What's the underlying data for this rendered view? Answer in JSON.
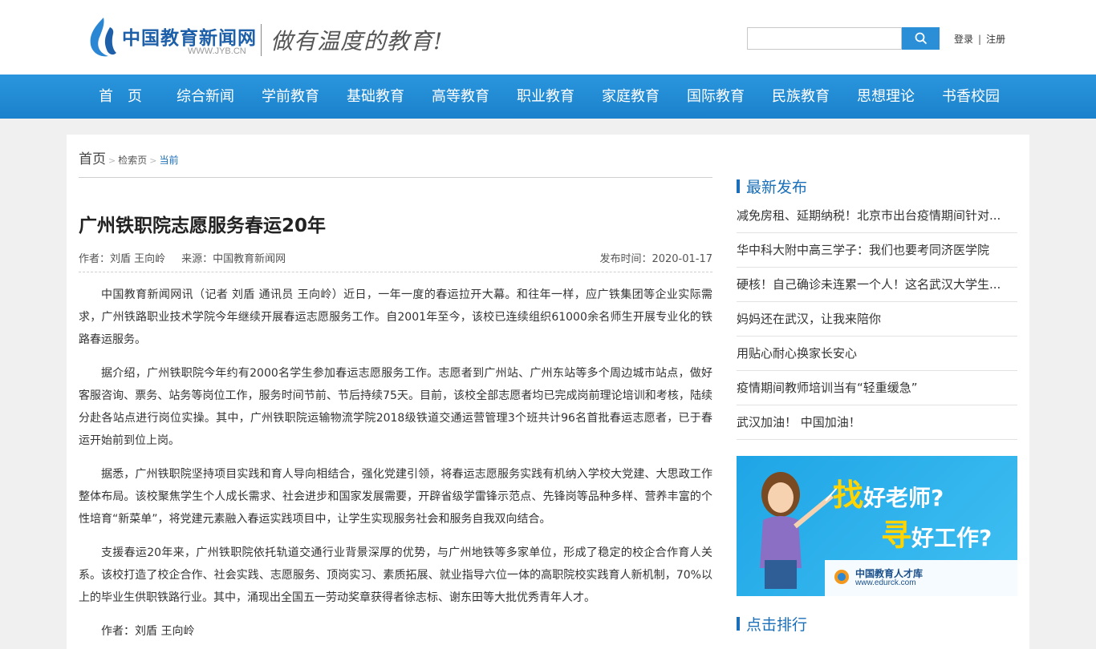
{
  "header": {
    "logo_name": "中国教育新闻网",
    "logo_url": "WWW.JYB.CN",
    "slogan": "做有温度的教育!",
    "search_placeholder": "",
    "login": "登录",
    "register": "注册",
    "separator": "|"
  },
  "nav": {
    "items": [
      "首　页",
      "综合新闻",
      "学前教育",
      "基础教育",
      "高等教育",
      "职业教育",
      "家庭教育",
      "国际教育",
      "民族教育",
      "思想理论",
      "书香校园"
    ]
  },
  "breadcrumb": {
    "home": "首页",
    "search": "检索页",
    "current": "当前"
  },
  "article": {
    "title": "广州铁职院志愿服务春运20年",
    "author": "作者：刘盾 王向岭",
    "source": "来源：中国教育新闻网",
    "date": "发布时间：2020-01-17",
    "paragraphs": [
      "中国教育新闻网讯（记者 刘盾 通讯员 王向岭）近日，一年一度的春运拉开大幕。和往年一样，应广铁集团等企业实际需求，广州铁路职业技术学院今年继续开展春运志愿服务工作。自2001年至今，该校已连续组织61000余名师生开展专业化的铁路春运服务。",
      "据介绍，广州铁职院今年约有2000名学生参加春运志愿服务工作。志愿者到广州站、广州东站等多个周边城市站点，做好客服咨询、票务、站务等岗位工作，服务时间节前、节后持续75天。目前，该校全部志愿者均已完成岗前理论培训和考核，陆续分赴各站点进行岗位实操。其中，广州铁职院运输物流学院2018级铁道交通运营管理3个班共计96名首批春运志愿者，已于春运开始前到位上岗。",
      "据悉，广州铁职院坚持项目实践和育人导向相结合，强化党建引领，将春运志愿服务实践有机纳入学校大党建、大思政工作整体布局。该校聚焦学生个人成长需求、社会进步和国家发展需要，开辟省级学雷锋示范点、先锋岗等品种多样、营养丰富的个性培育“新菜单”，将党建元素融入春运实践项目中，让学生实现服务社会和服务自我双向结合。",
      "支援春运20年来，广州铁职院依托轨道交通行业背景深厚的优势，与广州地铁等多家单位，形成了稳定的校企合作育人关系。该校打造了校企合作、社会实践、志愿服务、顶岗实习、素质拓展、就业指导六位一体的高职院校实践育人新机制，70%以上的毕业生供职铁路行业。其中，涌现出全国五一劳动奖章获得者徐志标、谢东田等大批优秀青年人才。",
      "作者：刘盾 王向岭"
    ]
  },
  "sidebar": {
    "latest_title": "最新发布",
    "latest_items": [
      "减免房租、延期纳税！北京市出台疫情期间针对...",
      "华中科大附中高三学子：我们也要考同济医学院",
      "硬核！自己确诊未连累一个人！这名武汉大学生...",
      "妈妈还在武汉，让我来陪你",
      "用贴心耐心换家长安心",
      "疫情期间教师培训当有“轻重缓急”",
      "武汉加油！ 中国加油！"
    ],
    "banner": {
      "hl1": "找",
      "line1": "好老师?",
      "hl2": "寻",
      "line2": "好工作?",
      "org": "中国教育人才库",
      "url": "www.edurck.com"
    },
    "rank_title": "点击排行"
  },
  "colors": {
    "nav_blue": "#1a82cc",
    "accent_blue": "#1a6fb8",
    "search_blue": "#2b8fd8"
  }
}
